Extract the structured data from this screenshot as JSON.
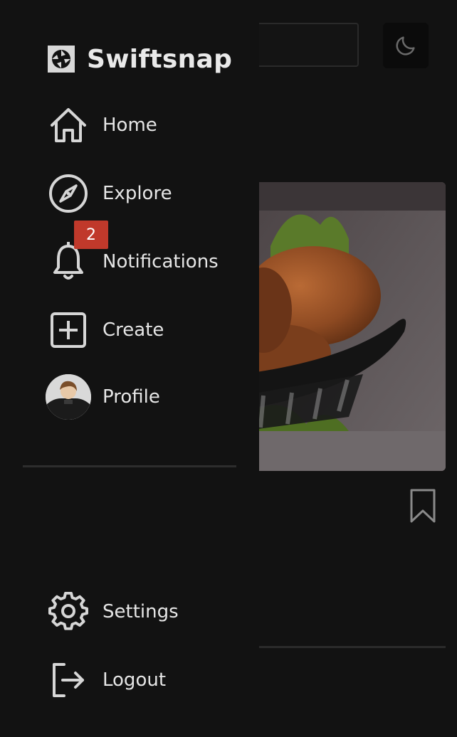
{
  "app": {
    "name": "Swiftsnap"
  },
  "nav": {
    "home": "Home",
    "explore": "Explore",
    "notifications": "Notifications",
    "notifications_count": "2",
    "create": "Create",
    "profile": "Profile"
  },
  "footer_nav": {
    "settings": "Settings",
    "logout": "Logout"
  },
  "icons": {
    "brand": "camera-shutter-icon",
    "home": "home-icon",
    "explore": "compass-icon",
    "notifications": "bell-icon",
    "create": "plus-square-icon",
    "settings": "gear-icon",
    "logout": "logout-icon",
    "theme": "moon-icon",
    "bookmark": "bookmark-icon"
  },
  "colors": {
    "drawer_bg": "#121212",
    "badge": "#c0392b",
    "text": "#e6e6e6",
    "icon": "#d6d6d6"
  }
}
